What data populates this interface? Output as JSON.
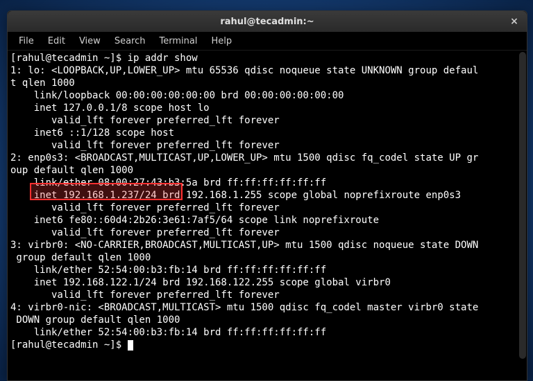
{
  "window": {
    "title": "rahul@tecadmin:~",
    "close_glyph": "×"
  },
  "menu": {
    "items": [
      "File",
      "Edit",
      "View",
      "Search",
      "Terminal",
      "Help"
    ]
  },
  "highlight": {
    "text": "inet 192.168.1.237/24"
  },
  "terminal": {
    "prompt1": "[rahul@tecadmin ~]$ ",
    "command1": "ip addr show",
    "line01": "1: lo: <LOOPBACK,UP,LOWER_UP> mtu 65536 qdisc noqueue state UNKNOWN group defaul",
    "line02": "t qlen 1000",
    "line03": "    link/loopback 00:00:00:00:00:00 brd 00:00:00:00:00:00",
    "line04": "    inet 127.0.0.1/8 scope host lo",
    "line05": "       valid_lft forever preferred_lft forever",
    "line06": "    inet6 ::1/128 scope host ",
    "line07": "       valid_lft forever preferred_lft forever",
    "line08": "2: enp0s3: <BROADCAST,MULTICAST,UP,LOWER_UP> mtu 1500 qdisc fq_codel state UP gr",
    "line09": "oup default qlen 1000",
    "line10": "    link/ether 08:00:27:43:b3:5a brd ff:ff:ff:ff:ff:ff",
    "line11a": "    ",
    "line11b": "inet 192.168.1.237/24",
    "line11c": " brd 192.168.1.255 scope global noprefixroute enp0s3",
    "line12": "       valid_lft forever preferred_lft forever",
    "line13": "    inet6 fe80::60d4:2b26:3e61:7af5/64 scope link noprefixroute ",
    "line14": "       valid_lft forever preferred_lft forever",
    "line15": "3: virbr0: <NO-CARRIER,BROADCAST,MULTICAST,UP> mtu 1500 qdisc noqueue state DOWN",
    "line16": " group default qlen 1000",
    "line17": "    link/ether 52:54:00:b3:fb:14 brd ff:ff:ff:ff:ff:ff",
    "line18": "    inet 192.168.122.1/24 brd 192.168.122.255 scope global virbr0",
    "line19": "       valid_lft forever preferred_lft forever",
    "line20": "4: virbr0-nic: <BROADCAST,MULTICAST> mtu 1500 qdisc fq_codel master virbr0 state",
    "line21": " DOWN group default qlen 1000",
    "line22": "    link/ether 52:54:00:b3:fb:14 brd ff:ff:ff:ff:ff:ff",
    "prompt2": "[rahul@tecadmin ~]$ "
  }
}
